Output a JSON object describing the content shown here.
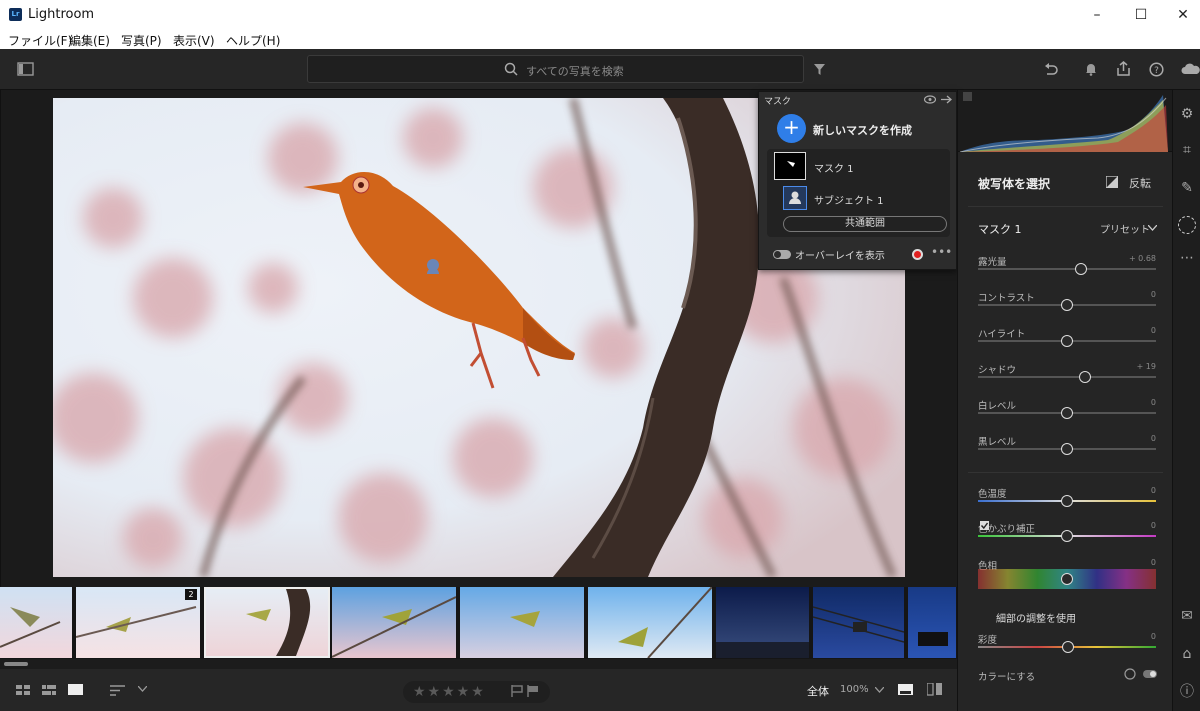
{
  "window": {
    "title": "Lightroom",
    "logo": "Lr"
  },
  "menu": [
    "ファイル(F)",
    "編集(E)",
    "写真(P)",
    "表示(V)",
    "ヘルプ(H)"
  ],
  "toolbar": {
    "search_placeholder": "すべての写真を検索"
  },
  "mask_panel": {
    "title": "マスク",
    "new_mask": "新しいマスクを作成",
    "mask1": "マスク 1",
    "subject1": "サブジェクト 1",
    "common": "共通範囲",
    "overlay": "オーバーレイを表示"
  },
  "filmstrip": {
    "badge": "2"
  },
  "bottom": {
    "fit": "全体",
    "zoom": "100%"
  },
  "right_panel": {
    "select_subject": "被写体を選択",
    "invert": "反転",
    "mask_name": "マスク 1",
    "preset": "プリセット",
    "sliders": [
      {
        "label": "露光量",
        "value": "+ 0.68",
        "pos": 0.58
      },
      {
        "label": "コントラスト",
        "value": "0",
        "pos": 0.5
      },
      {
        "label": "ハイライト",
        "value": "0",
        "pos": 0.5
      },
      {
        "label": "シャドウ",
        "value": "+ 19",
        "pos": 0.6
      },
      {
        "label": "白レベル",
        "value": "0",
        "pos": 0.5
      },
      {
        "label": "黒レベル",
        "value": "0",
        "pos": 0.5
      },
      {
        "label": "色温度",
        "value": "0",
        "pos": 0.5
      },
      {
        "label": "色かぶり補正",
        "value": "0",
        "pos": 0.5
      },
      {
        "label": "色相",
        "value": "0",
        "pos": 0.5
      }
    ],
    "fine_adjust": "細部の調整を使用",
    "saturation": {
      "label": "彩度",
      "value": "0"
    },
    "colorize": "カラーにする"
  },
  "colors": {
    "accent": "#2f7ee8",
    "bird": "#d2651a"
  }
}
